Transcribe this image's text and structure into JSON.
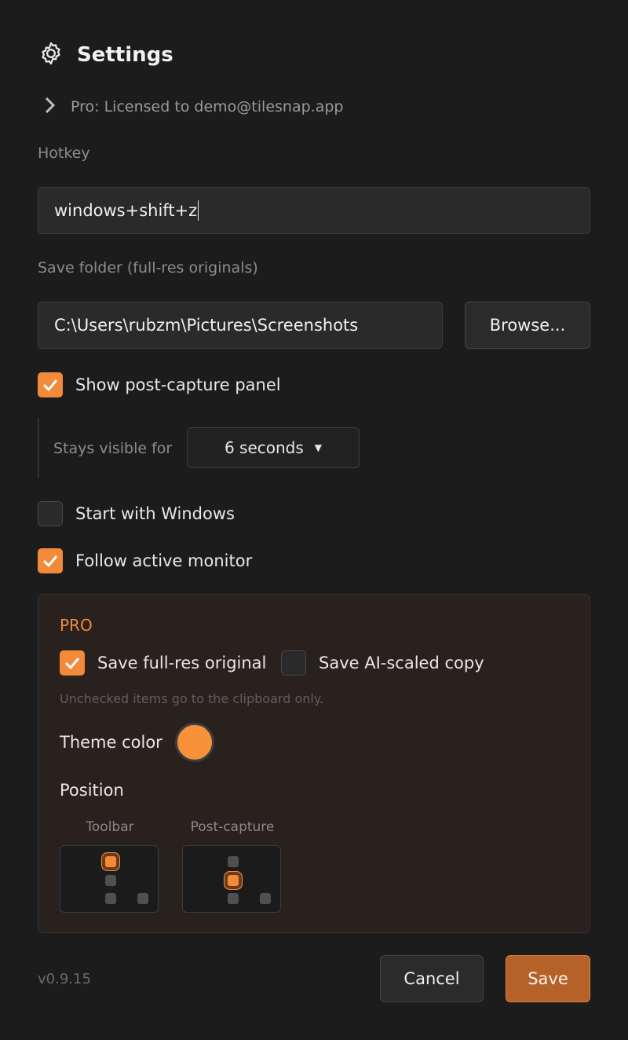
{
  "header": {
    "title": "Settings",
    "icon": "gear-icon"
  },
  "license": {
    "text": "Pro: Licensed to demo@tilesnap.app"
  },
  "hotkey": {
    "label": "Hotkey",
    "value": "windows+shift+z"
  },
  "save_folder": {
    "label": "Save folder (full-res originals)",
    "value": "C:\\Users\\rubzm\\Pictures\\Screenshots",
    "browse_label": "Browse..."
  },
  "post_capture": {
    "label": "Show post-capture panel",
    "checked": true,
    "stays_label": "Stays visible for",
    "duration": "6 seconds"
  },
  "start_windows": {
    "label": "Start with Windows",
    "checked": false
  },
  "follow_monitor": {
    "label": "Follow active monitor",
    "checked": true
  },
  "pro": {
    "tag": "PRO",
    "save_full": {
      "label": "Save full-res original",
      "checked": true
    },
    "save_ai": {
      "label": "Save AI-scaled copy",
      "checked": false
    },
    "hint": "Unchecked items go to the clipboard only.",
    "theme_label": "Theme color",
    "theme_color": "#f7923a",
    "position_label": "Position",
    "toolbar_label": "Toolbar",
    "postcapture_label": "Post-capture"
  },
  "footer": {
    "version": "v0.9.15",
    "cancel": "Cancel",
    "save": "Save"
  },
  "colors": {
    "accent": "#f28a3a",
    "background": "#1c1c1c"
  }
}
